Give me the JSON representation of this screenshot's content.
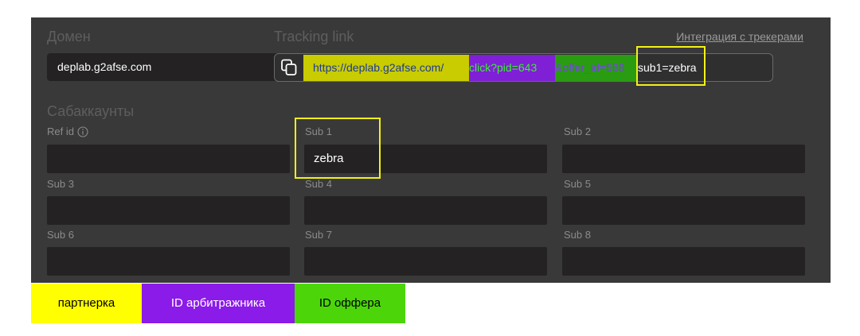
{
  "header": {
    "domain_label": "Домен",
    "tracking_label": "Tracking link",
    "trackers_link": "Интеграция с трекерами"
  },
  "domain_select": {
    "value": "deplab.g2afse.com"
  },
  "tracking_link": {
    "partner_part": "https://deplab.g2afse.com/",
    "arbitrageur_part": "click?pid=643",
    "offer_part": "&offer_id=588",
    "sub_part": "sub1=zebra"
  },
  "subaccounts": {
    "title": "Сабаккаунты",
    "fields": [
      {
        "label": "Ref id",
        "value": ""
      },
      {
        "label": "Sub 1",
        "value": "zebra"
      },
      {
        "label": "Sub 2",
        "value": ""
      },
      {
        "label": "Sub 3",
        "value": ""
      },
      {
        "label": "Sub 4",
        "value": ""
      },
      {
        "label": "Sub 5",
        "value": ""
      },
      {
        "label": "Sub 6",
        "value": ""
      },
      {
        "label": "Sub 7",
        "value": ""
      },
      {
        "label": "Sub 8",
        "value": ""
      }
    ]
  },
  "legend": {
    "partner": "партнерка",
    "arbitrageur": "ID арбитражника",
    "offer": "ID оффера"
  },
  "colors": {
    "panel": "#3a3939",
    "highlight": "#f2f218",
    "legend_partner": "#ffff00",
    "legend_arbitrageur": "#8a1be8",
    "legend_offer": "#4cd60a"
  },
  "icons": {
    "copy": "copy-icon",
    "chevron": "chevron-down-icon",
    "info": "info-icon"
  }
}
